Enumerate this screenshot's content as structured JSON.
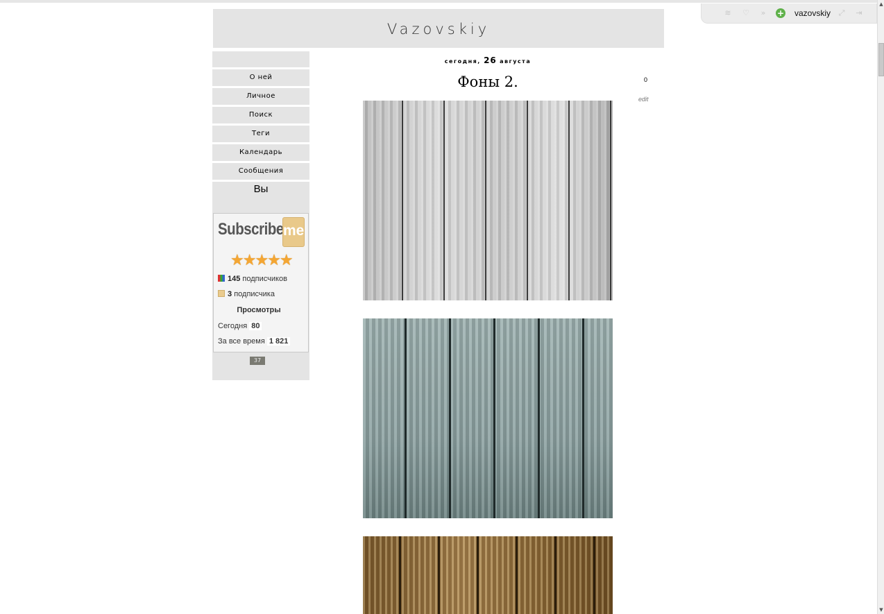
{
  "topbar": {
    "username": "vazovskiy",
    "icons": [
      "rss-icon",
      "heart-icon",
      "forward-icon",
      "add-icon",
      "resize-icon",
      "logout-icon"
    ]
  },
  "header": {
    "title": "Vazovskiy"
  },
  "sidebar": {
    "nav": [
      {
        "label": "О ней"
      },
      {
        "label": "Личное"
      },
      {
        "label": "Поиск"
      },
      {
        "label": "Теги"
      },
      {
        "label": "Календарь"
      },
      {
        "label": "Сообщения"
      }
    ],
    "section_title": "Вы",
    "widget": {
      "brand": "Subscribe",
      "brand_badge": "me",
      "stars": "★★★★★",
      "subscribers_count": "145",
      "subscribers_label": "подписчиков",
      "subscribers2_count": "3",
      "subscribers2_label": "подписчика",
      "views_title": "Просмотры",
      "today_label": "Сегодня",
      "today_value": "80",
      "all_label": "За все время",
      "all_value": "1 821"
    },
    "counter": "37"
  },
  "post": {
    "date_prefix": "сегодня,",
    "date_day": "26",
    "date_month": "августа",
    "title": "Фоны 2.",
    "comments": "0",
    "edit": "edit"
  }
}
